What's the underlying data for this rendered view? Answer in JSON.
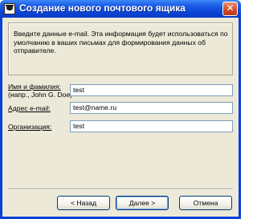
{
  "window": {
    "title": "Создание нового почтового ящика",
    "close_glyph": "✕",
    "app_icon": "thunderbird-icon"
  },
  "description": "Введите данные e-mail. Эта информация будет использоваться по умолчанию в ваших письмах для формирования данных об отправителе.",
  "form": {
    "name_label_line1": "Имя и фамилия:",
    "name_label_line2": "(напр., John G. Doe)",
    "name_value": "test",
    "email_label": "Адрес e-mail:",
    "email_value": "test@name.ru",
    "org_label": "Организация:",
    "org_value": "test"
  },
  "buttons": {
    "back": "< Назад",
    "next": "Далее >",
    "cancel": "Отмена"
  }
}
